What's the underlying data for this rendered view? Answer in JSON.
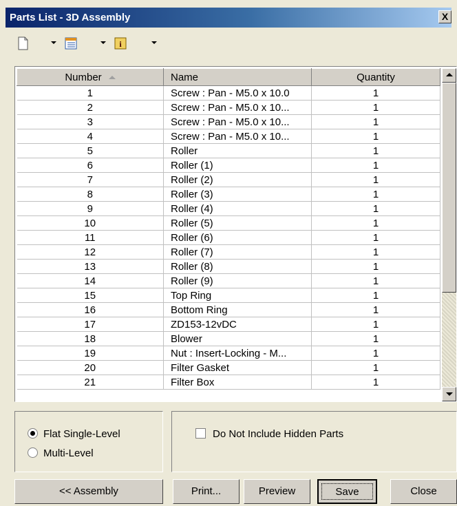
{
  "window": {
    "title": "Parts List - 3D Assembly",
    "close_label": "X"
  },
  "toolbar": {
    "items": [
      {
        "icon": "new-document-icon"
      },
      {
        "icon": "list-view-icon"
      },
      {
        "icon": "properties-icon"
      }
    ]
  },
  "table": {
    "columns": {
      "number": "Number",
      "name": "Name",
      "quantity": "Quantity"
    },
    "rows": [
      {
        "number": "1",
        "name": "Screw : Pan - M5.0 x 10.0",
        "quantity": "1"
      },
      {
        "number": "2",
        "name": "Screw : Pan - M5.0 x 10...",
        "quantity": "1"
      },
      {
        "number": "3",
        "name": "Screw : Pan - M5.0 x 10...",
        "quantity": "1"
      },
      {
        "number": "4",
        "name": "Screw : Pan - M5.0 x 10...",
        "quantity": "1"
      },
      {
        "number": "5",
        "name": "Roller",
        "quantity": "1"
      },
      {
        "number": "6",
        "name": "Roller (1)",
        "quantity": "1"
      },
      {
        "number": "7",
        "name": "Roller (2)",
        "quantity": "1"
      },
      {
        "number": "8",
        "name": "Roller (3)",
        "quantity": "1"
      },
      {
        "number": "9",
        "name": "Roller (4)",
        "quantity": "1"
      },
      {
        "number": "10",
        "name": "Roller (5)",
        "quantity": "1"
      },
      {
        "number": "11",
        "name": "Roller (6)",
        "quantity": "1"
      },
      {
        "number": "12",
        "name": "Roller (7)",
        "quantity": "1"
      },
      {
        "number": "13",
        "name": "Roller (8)",
        "quantity": "1"
      },
      {
        "number": "14",
        "name": "Roller (9)",
        "quantity": "1"
      },
      {
        "number": "15",
        "name": "Top Ring",
        "quantity": "1"
      },
      {
        "number": "16",
        "name": "Bottom Ring",
        "quantity": "1"
      },
      {
        "number": "17",
        "name": "ZD153-12vDC",
        "quantity": "1"
      },
      {
        "number": "18",
        "name": "Blower",
        "quantity": "1"
      },
      {
        "number": "19",
        "name": "Nut : Insert-Locking - M...",
        "quantity": "1"
      },
      {
        "number": "20",
        "name": "Filter Gasket",
        "quantity": "1"
      },
      {
        "number": "21",
        "name": "Filter Box",
        "quantity": "1"
      }
    ]
  },
  "options": {
    "flat_label": "Flat Single-Level",
    "multi_label": "Multi-Level",
    "selected": "Flat Single-Level",
    "hidden_parts_label": "Do Not Include Hidden Parts",
    "hidden_parts_checked": false
  },
  "buttons": {
    "assembly": "<< Assembly",
    "print": "Print...",
    "preview": "Preview",
    "save": "Save",
    "close": "Close"
  }
}
